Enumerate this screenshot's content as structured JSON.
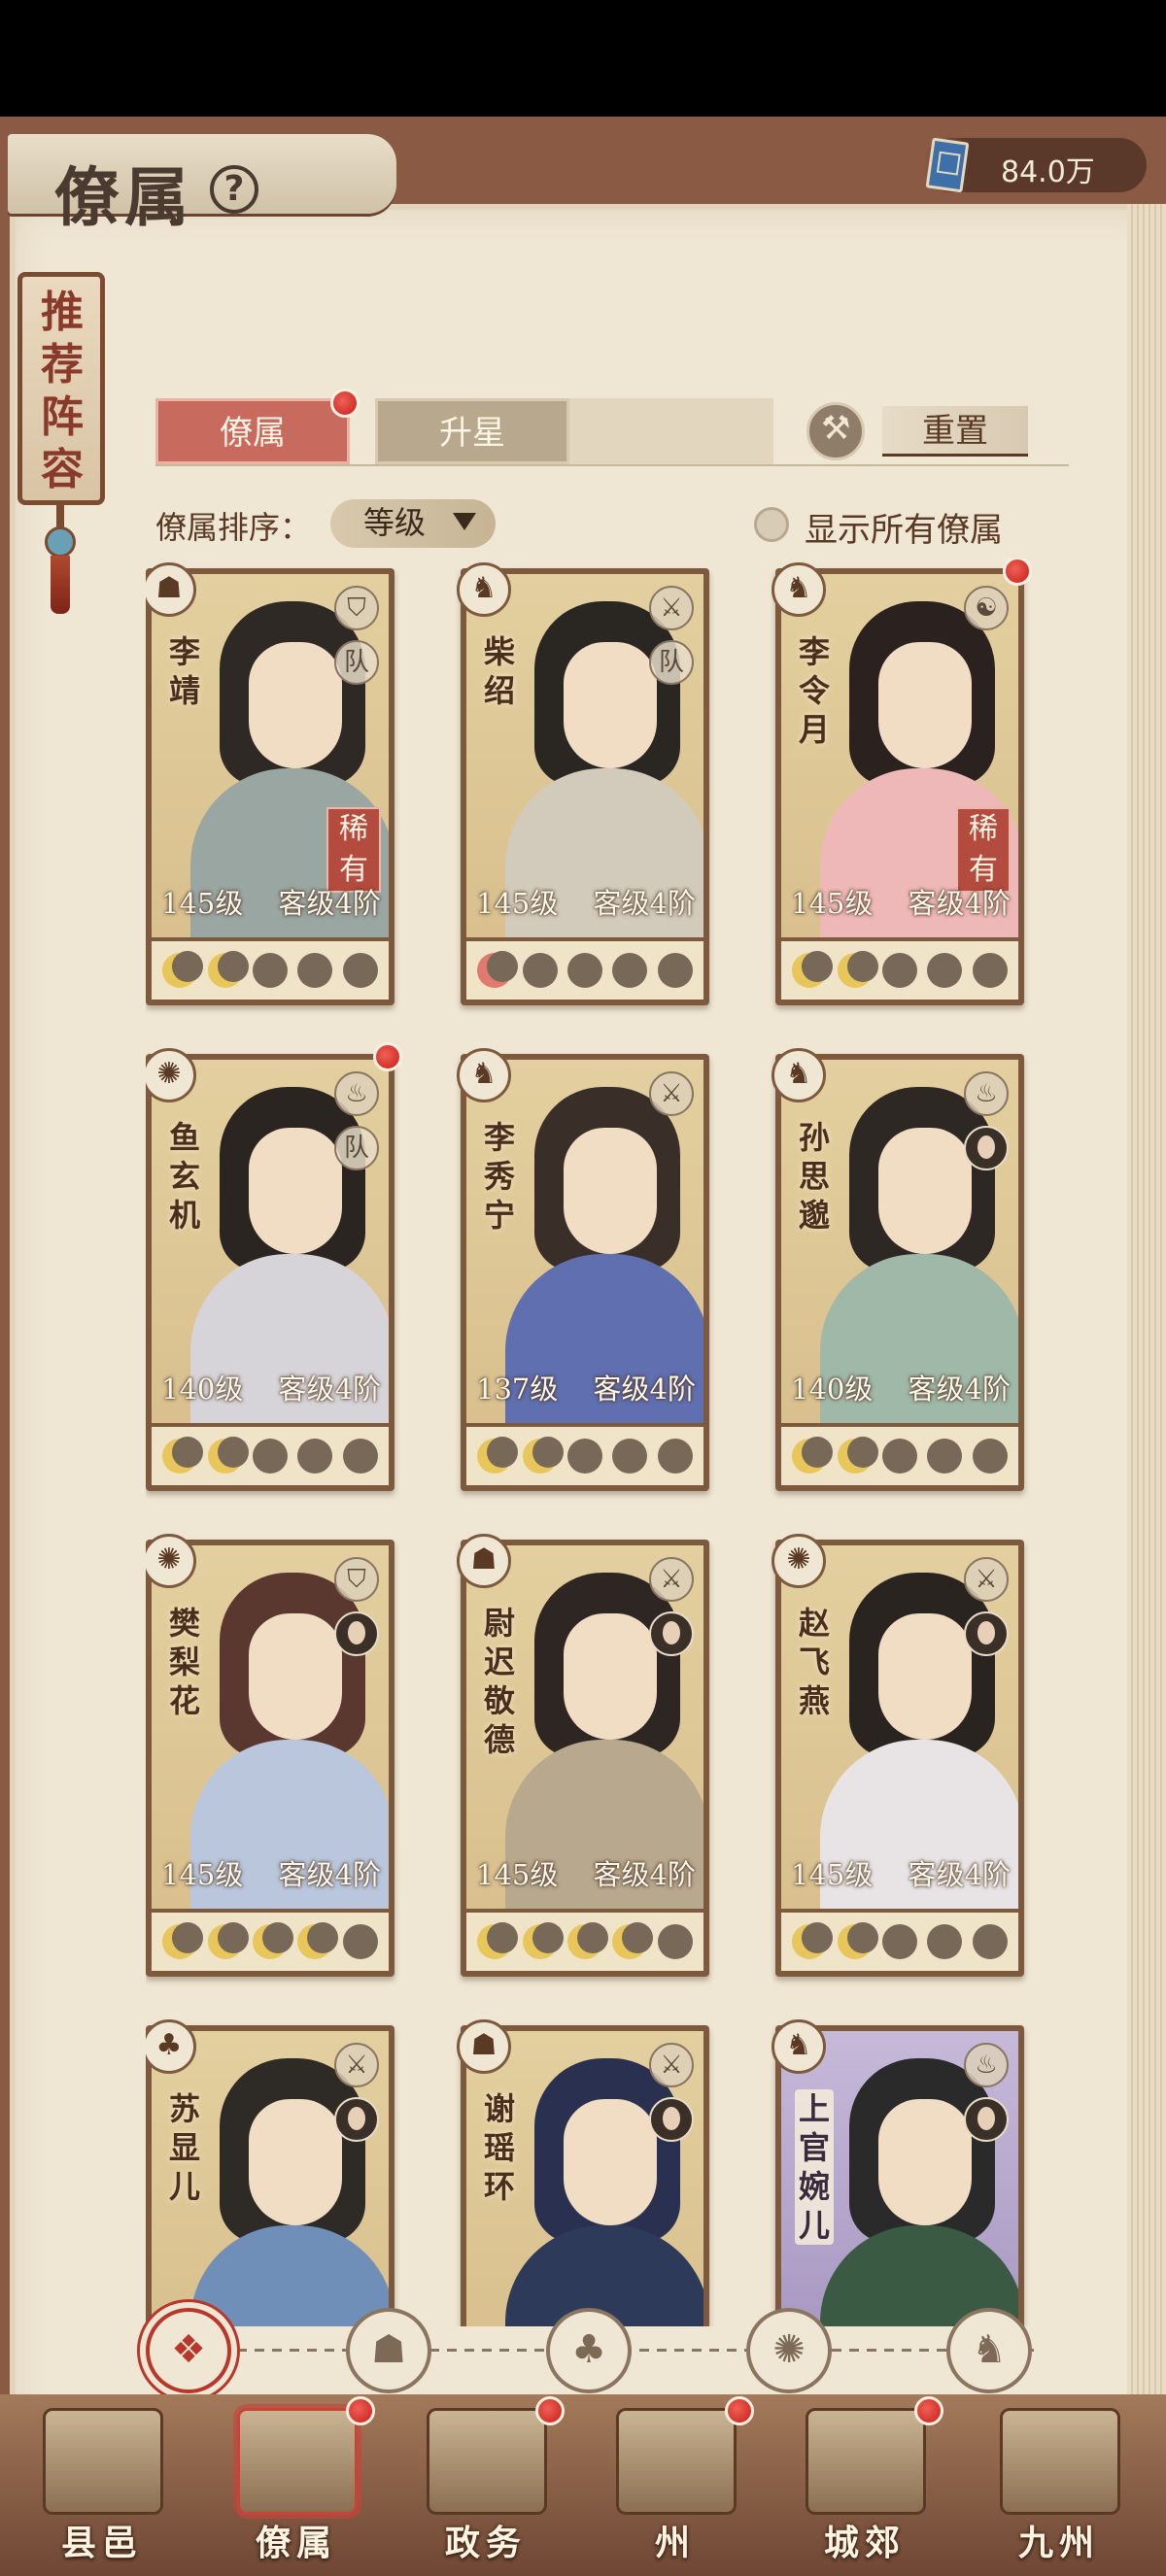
{
  "header": {
    "title": "僚属",
    "help_icon": "?",
    "currency_icon": "book-icon",
    "currency_value": "84.0万"
  },
  "recommend_tag": "推荐阵容",
  "tabs": [
    {
      "label": "僚属",
      "active": true,
      "badge": true
    },
    {
      "label": "升星",
      "active": false,
      "badge": false
    }
  ],
  "reset_label": "重置",
  "sort": {
    "label": "僚属排序：",
    "selected": "等级"
  },
  "show_all_label": "显示所有僚属",
  "cards": [
    {
      "name": "李靖",
      "level": "145级",
      "guest": "客级4阶",
      "role_icon": "shield-icon",
      "badge": "队",
      "rare": "稀有",
      "moons": 2,
      "moon_color": "gold",
      "red_dot": false
    },
    {
      "name": "柴绍",
      "level": "145级",
      "guest": "客级4阶",
      "role_icon": "sword-icon",
      "badge": "队",
      "rare": "",
      "moons": 1,
      "moon_color": "red",
      "red_dot": false
    },
    {
      "name": "李令月",
      "level": "145级",
      "guest": "客级4阶",
      "role_icon": "taiji-icon",
      "badge": "",
      "rare": "稀有",
      "moons": 2,
      "moon_color": "gold",
      "red_dot": true
    },
    {
      "name": "鱼玄机",
      "level": "140级",
      "guest": "客级4阶",
      "role_icon": "cauldron-icon",
      "badge": "队",
      "rare": "",
      "moons": 2,
      "moon_color": "gold",
      "red_dot": true
    },
    {
      "name": "李秀宁",
      "level": "137级",
      "guest": "客级4阶",
      "role_icon": "sword-icon",
      "badge": "",
      "rare": "",
      "moons": 2,
      "moon_color": "gold",
      "red_dot": false
    },
    {
      "name": "孙思邈",
      "level": "140级",
      "guest": "客级4阶",
      "role_icon": "cauldron-icon",
      "badge": "avatar",
      "rare": "",
      "moons": 2,
      "moon_color": "gold",
      "red_dot": false
    },
    {
      "name": "樊梨花",
      "level": "145级",
      "guest": "客级4阶",
      "role_icon": "shield-icon",
      "badge": "avatar",
      "rare": "",
      "moons": 4,
      "moon_color": "gold",
      "red_dot": false
    },
    {
      "name": "尉迟敬德",
      "level": "145级",
      "guest": "客级4阶",
      "role_icon": "sword-icon",
      "badge": "avatar",
      "rare": "",
      "moons": 4,
      "moon_color": "gold",
      "red_dot": false
    },
    {
      "name": "赵飞燕",
      "level": "145级",
      "guest": "客级4阶",
      "role_icon": "sword-icon",
      "badge": "avatar",
      "rare": "",
      "moons": 2,
      "moon_color": "gold",
      "red_dot": false
    },
    {
      "name": "苏显儿",
      "level": "",
      "guest": "",
      "role_icon": "sword-icon",
      "badge": "avatar",
      "rare": "",
      "moons": 0,
      "moon_color": "gold",
      "red_dot": false
    },
    {
      "name": "谢瑶环",
      "level": "",
      "guest": "",
      "role_icon": "sword-icon",
      "badge": "avatar",
      "rare": "",
      "moons": 0,
      "moon_color": "gold",
      "red_dot": false
    },
    {
      "name": "上官婉儿",
      "level": "",
      "guest": "",
      "role_icon": "cauldron-icon",
      "badge": "avatar",
      "rare": "",
      "moons": 0,
      "moon_color": "gold",
      "red_dot": false
    }
  ],
  "filters": [
    {
      "icon": "all-icon",
      "glyph": "❖",
      "active": true
    },
    {
      "icon": "helmet-icon",
      "glyph": "☗",
      "active": false
    },
    {
      "icon": "gourd-icon",
      "glyph": "♣",
      "active": false
    },
    {
      "icon": "fan-icon",
      "glyph": "✺",
      "active": false
    },
    {
      "icon": "horse-icon",
      "glyph": "♞",
      "active": false
    }
  ],
  "nav": [
    {
      "label": "县邑",
      "icon": "town-icon",
      "active": false,
      "badge": false
    },
    {
      "label": "僚属",
      "icon": "scroll-icon",
      "active": true,
      "badge": true
    },
    {
      "label": "政务",
      "icon": "documents-icon",
      "active": false,
      "badge": true
    },
    {
      "label": "州",
      "icon": "pavilion-icon",
      "active": false,
      "badge": true
    },
    {
      "label": "城郊",
      "icon": "farm-icon",
      "active": false,
      "badge": true
    },
    {
      "label": "九州",
      "icon": "map-icon",
      "active": false,
      "badge": false
    }
  ]
}
